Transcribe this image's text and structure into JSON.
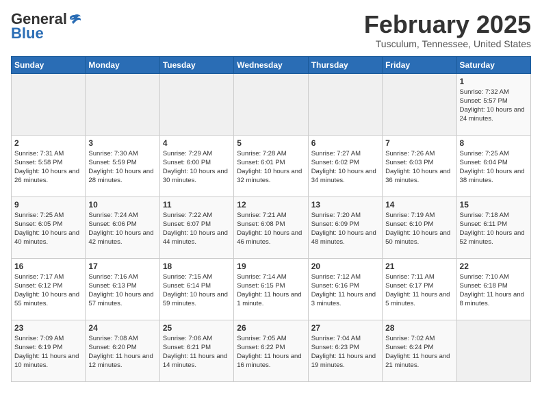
{
  "header": {
    "logo_general": "General",
    "logo_blue": "Blue",
    "title": "February 2025",
    "subtitle": "Tusculum, Tennessee, United States"
  },
  "days_of_week": [
    "Sunday",
    "Monday",
    "Tuesday",
    "Wednesday",
    "Thursday",
    "Friday",
    "Saturday"
  ],
  "weeks": [
    [
      {
        "day": "",
        "empty": true
      },
      {
        "day": "",
        "empty": true
      },
      {
        "day": "",
        "empty": true
      },
      {
        "day": "",
        "empty": true
      },
      {
        "day": "",
        "empty": true
      },
      {
        "day": "",
        "empty": true
      },
      {
        "day": "1",
        "sunrise": "7:32 AM",
        "sunset": "5:57 PM",
        "daylight": "10 hours and 24 minutes."
      }
    ],
    [
      {
        "day": "2",
        "sunrise": "7:31 AM",
        "sunset": "5:58 PM",
        "daylight": "10 hours and 26 minutes."
      },
      {
        "day": "3",
        "sunrise": "7:30 AM",
        "sunset": "5:59 PM",
        "daylight": "10 hours and 28 minutes."
      },
      {
        "day": "4",
        "sunrise": "7:29 AM",
        "sunset": "6:00 PM",
        "daylight": "10 hours and 30 minutes."
      },
      {
        "day": "5",
        "sunrise": "7:28 AM",
        "sunset": "6:01 PM",
        "daylight": "10 hours and 32 minutes."
      },
      {
        "day": "6",
        "sunrise": "7:27 AM",
        "sunset": "6:02 PM",
        "daylight": "10 hours and 34 minutes."
      },
      {
        "day": "7",
        "sunrise": "7:26 AM",
        "sunset": "6:03 PM",
        "daylight": "10 hours and 36 minutes."
      },
      {
        "day": "8",
        "sunrise": "7:25 AM",
        "sunset": "6:04 PM",
        "daylight": "10 hours and 38 minutes."
      }
    ],
    [
      {
        "day": "9",
        "sunrise": "7:25 AM",
        "sunset": "6:05 PM",
        "daylight": "10 hours and 40 minutes."
      },
      {
        "day": "10",
        "sunrise": "7:24 AM",
        "sunset": "6:06 PM",
        "daylight": "10 hours and 42 minutes."
      },
      {
        "day": "11",
        "sunrise": "7:22 AM",
        "sunset": "6:07 PM",
        "daylight": "10 hours and 44 minutes."
      },
      {
        "day": "12",
        "sunrise": "7:21 AM",
        "sunset": "6:08 PM",
        "daylight": "10 hours and 46 minutes."
      },
      {
        "day": "13",
        "sunrise": "7:20 AM",
        "sunset": "6:09 PM",
        "daylight": "10 hours and 48 minutes."
      },
      {
        "day": "14",
        "sunrise": "7:19 AM",
        "sunset": "6:10 PM",
        "daylight": "10 hours and 50 minutes."
      },
      {
        "day": "15",
        "sunrise": "7:18 AM",
        "sunset": "6:11 PM",
        "daylight": "10 hours and 52 minutes."
      }
    ],
    [
      {
        "day": "16",
        "sunrise": "7:17 AM",
        "sunset": "6:12 PM",
        "daylight": "10 hours and 55 minutes."
      },
      {
        "day": "17",
        "sunrise": "7:16 AM",
        "sunset": "6:13 PM",
        "daylight": "10 hours and 57 minutes."
      },
      {
        "day": "18",
        "sunrise": "7:15 AM",
        "sunset": "6:14 PM",
        "daylight": "10 hours and 59 minutes."
      },
      {
        "day": "19",
        "sunrise": "7:14 AM",
        "sunset": "6:15 PM",
        "daylight": "11 hours and 1 minute."
      },
      {
        "day": "20",
        "sunrise": "7:12 AM",
        "sunset": "6:16 PM",
        "daylight": "11 hours and 3 minutes."
      },
      {
        "day": "21",
        "sunrise": "7:11 AM",
        "sunset": "6:17 PM",
        "daylight": "11 hours and 5 minutes."
      },
      {
        "day": "22",
        "sunrise": "7:10 AM",
        "sunset": "6:18 PM",
        "daylight": "11 hours and 8 minutes."
      }
    ],
    [
      {
        "day": "23",
        "sunrise": "7:09 AM",
        "sunset": "6:19 PM",
        "daylight": "11 hours and 10 minutes."
      },
      {
        "day": "24",
        "sunrise": "7:08 AM",
        "sunset": "6:20 PM",
        "daylight": "11 hours and 12 minutes."
      },
      {
        "day": "25",
        "sunrise": "7:06 AM",
        "sunset": "6:21 PM",
        "daylight": "11 hours and 14 minutes."
      },
      {
        "day": "26",
        "sunrise": "7:05 AM",
        "sunset": "6:22 PM",
        "daylight": "11 hours and 16 minutes."
      },
      {
        "day": "27",
        "sunrise": "7:04 AM",
        "sunset": "6:23 PM",
        "daylight": "11 hours and 19 minutes."
      },
      {
        "day": "28",
        "sunrise": "7:02 AM",
        "sunset": "6:24 PM",
        "daylight": "11 hours and 21 minutes."
      },
      {
        "day": "",
        "empty": true
      }
    ]
  ]
}
